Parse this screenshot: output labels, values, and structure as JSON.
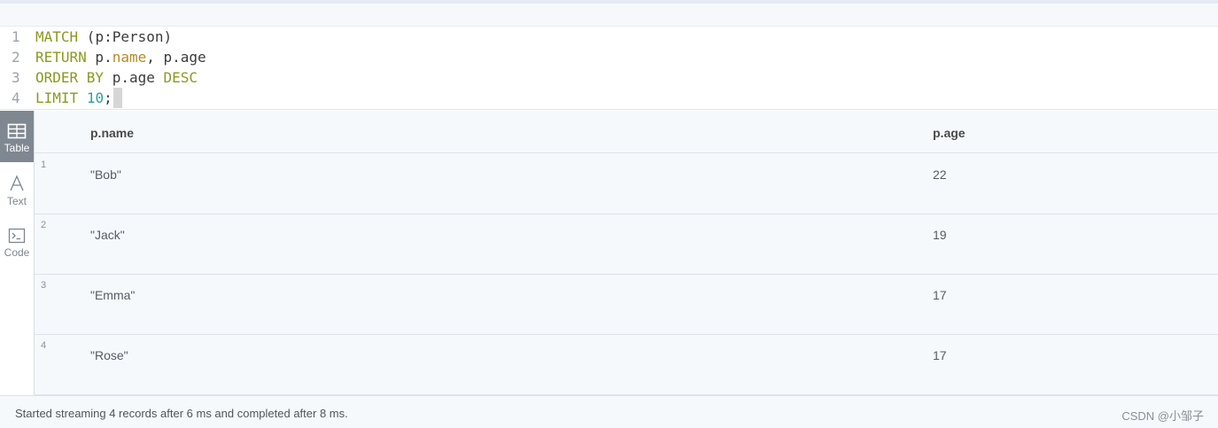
{
  "editor": {
    "lines": [
      {
        "no": "1",
        "tokens": [
          [
            "kw",
            "MATCH"
          ],
          [
            "plain",
            " (p:Person)"
          ]
        ]
      },
      {
        "no": "2",
        "tokens": [
          [
            "kw",
            "RETURN"
          ],
          [
            "plain",
            " p."
          ],
          [
            "prop",
            "name"
          ],
          [
            "plain",
            ", p.age"
          ]
        ]
      },
      {
        "no": "3",
        "tokens": [
          [
            "kw",
            "ORDER BY"
          ],
          [
            "plain",
            " p.age "
          ],
          [
            "kw",
            "DESC"
          ]
        ]
      },
      {
        "no": "4",
        "tokens": [
          [
            "kw",
            "LIMIT"
          ],
          [
            "plain",
            " "
          ],
          [
            "num",
            "10"
          ],
          [
            "plain",
            ";"
          ]
        ]
      }
    ]
  },
  "sidebar": {
    "table_label": "Table",
    "text_label": "Text",
    "code_label": "Code"
  },
  "table": {
    "headers": [
      "p.name",
      "p.age"
    ],
    "rows": [
      {
        "index": "1",
        "name": "\"Bob\"",
        "age": "22"
      },
      {
        "index": "2",
        "name": "\"Jack\"",
        "age": "19"
      },
      {
        "index": "3",
        "name": "\"Emma\"",
        "age": "17"
      },
      {
        "index": "4",
        "name": "\"Rose\"",
        "age": "17"
      }
    ]
  },
  "footer": {
    "status": "Started streaming 4 records after 6 ms and completed after 8 ms.",
    "watermark": "CSDN @小邹子"
  }
}
